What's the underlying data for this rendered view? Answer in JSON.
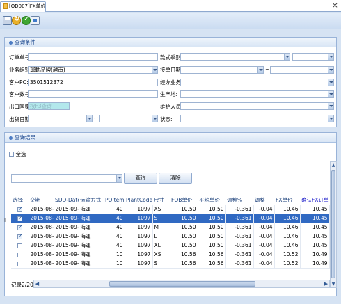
{
  "tab": {
    "title": "[OD007]FX单价确认"
  },
  "query_panel": {
    "title": "查询条件",
    "order_no": {
      "label": "订单单号:",
      "value": ""
    },
    "business_group": {
      "label": "业务组别:",
      "value": "運動品牌(越南)"
    },
    "customer_po": {
      "label": "客户PO:",
      "value": "3501512372"
    },
    "customer_no": {
      "label": "客户数号:",
      "value": ""
    },
    "export_country": {
      "label": "出口国家:",
      "placeholder": "按F3查询"
    },
    "ship_date": {
      "label": "出货日期:",
      "from": "",
      "to": "",
      "sep": "~"
    },
    "style_season": {
      "label": "款式季别:",
      "value": ""
    },
    "receive_date": {
      "label": "接单日期:",
      "from": "",
      "to": "",
      "sep": "~"
    },
    "sales": {
      "label": "经办业务:",
      "value": ""
    },
    "production_place": {
      "label": "生产地:",
      "value": ""
    },
    "maintainer": {
      "label": "维护人员:",
      "value": ""
    },
    "status": {
      "label": "状态:",
      "value": ""
    }
  },
  "result_panel": {
    "title": "查询结果",
    "select_all": "全选",
    "filter_input": "",
    "query_button": "查询",
    "clear_button": "清除",
    "columns": [
      "选择",
      "交期",
      "SDD-Date",
      "运输方式",
      "POItem",
      "PlantCode",
      "尺寸",
      "FOB单价",
      "平均单价",
      "调整%",
      "调整",
      "FX单价",
      "确认FX订单"
    ],
    "rows": [
      {
        "checked": true,
        "delivery": "2015-08-...",
        "sdd": "2015-09-...",
        "transport": "海運",
        "poitem": "40",
        "plant": "1097",
        "size": "XS",
        "fob": "10.50",
        "avg": "10.50",
        "adj_pct": "-0.361",
        "adj": "-0.04",
        "fx": "10.46",
        "confirm": "10.45",
        "selected": false
      },
      {
        "checked": true,
        "delivery": "2015-08-...",
        "sdd": "2015-09-...",
        "transport": "海運",
        "poitem": "40",
        "plant": "1097",
        "size": "S",
        "fob": "10.50",
        "avg": "10.50",
        "adj_pct": "-0.361",
        "adj": "-0.04",
        "fx": "10.46",
        "confirm": "10.45",
        "selected": true
      },
      {
        "checked": true,
        "delivery": "2015-08-...",
        "sdd": "2015-09-...",
        "transport": "海運",
        "poitem": "40",
        "plant": "1097",
        "size": "M",
        "fob": "10.50",
        "avg": "10.50",
        "adj_pct": "-0.361",
        "adj": "-0.04",
        "fx": "10.46",
        "confirm": "10.45",
        "selected": false
      },
      {
        "checked": true,
        "delivery": "2015-08-...",
        "sdd": "2015-09-...",
        "transport": "海運",
        "poitem": "40",
        "plant": "1097",
        "size": "L",
        "fob": "10.50",
        "avg": "10.50",
        "adj_pct": "-0.361",
        "adj": "-0.04",
        "fx": "10.46",
        "confirm": "10.45",
        "selected": false
      },
      {
        "checked": false,
        "delivery": "2015-08-...",
        "sdd": "2015-09-...",
        "transport": "海運",
        "poitem": "40",
        "plant": "1097",
        "size": "XL",
        "fob": "10.50",
        "avg": "10.50",
        "adj_pct": "-0.361",
        "adj": "-0.04",
        "fx": "10.46",
        "confirm": "10.45",
        "selected": false
      },
      {
        "checked": false,
        "delivery": "2015-08-...",
        "sdd": "2015-09-...",
        "transport": "海運",
        "poitem": "10",
        "plant": "1097",
        "size": "XS",
        "fob": "10.56",
        "avg": "10.56",
        "adj_pct": "-0.361",
        "adj": "-0.04",
        "fx": "10.52",
        "confirm": "10.49",
        "selected": false
      },
      {
        "checked": false,
        "delivery": "2015-08-...",
        "sdd": "2015-09-...",
        "transport": "海運",
        "poitem": "10",
        "plant": "1097",
        "size": "S",
        "fob": "10.56",
        "avg": "10.56",
        "adj_pct": "-0.361",
        "adj": "-0.04",
        "fx": "10.52",
        "confirm": "10.49",
        "selected": false
      }
    ],
    "record_text": "记录2/20"
  }
}
